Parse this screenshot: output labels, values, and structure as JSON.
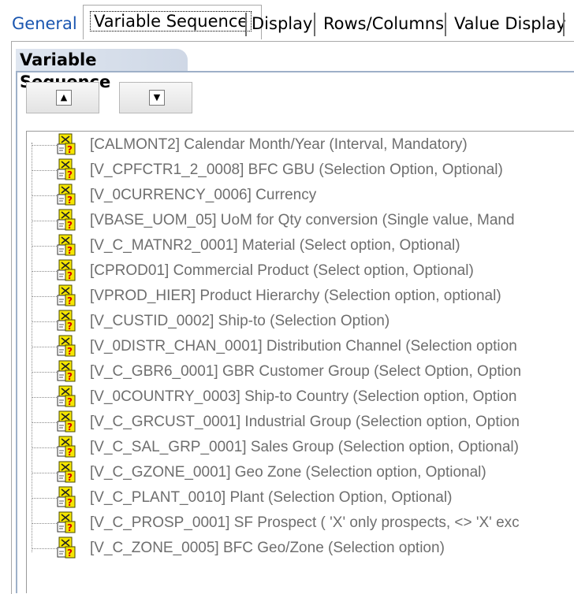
{
  "tabs": [
    {
      "label": "General"
    },
    {
      "label": "Variable Sequence"
    },
    {
      "label": "Display"
    },
    {
      "label": "Rows/Columns"
    },
    {
      "label": "Value Display"
    }
  ],
  "group": {
    "title": "Variable Sequence"
  },
  "buttons": {
    "up_icon": "arrow-up-icon",
    "down_icon": "arrow-down-icon"
  },
  "variables": [
    "[CALMONT2] Calendar Month/Year (Interval, Mandatory)",
    "[V_CPFCTR1_2_0008] BFC GBU (Selection Option, Optional)",
    "[V_0CURRENCY_0006] Currency",
    "[VBASE_UOM_05] UoM for Qty conversion (Single value, Mand",
    "[V_C_MATNR2_0001] Material (Select option, Optional)",
    "[CPROD01] Commercial Product (Select option, Optional)",
    "[VPROD_HIER] Product Hierarchy (Selection option, optional)",
    "[V_CUSTID_0002] Ship-to (Selection Option)",
    "[V_0DISTR_CHAN_0001] Distribution Channel (Selection option",
    "[V_C_GBR6_0001] GBR Customer Group (Select Option, Option",
    "[V_0COUNTRY_0003] Ship-to Country (Selection option, Option",
    "[V_C_GRCUST_0001] Industrial Group (Selection option, Option",
    "[V_C_SAL_GRP_0001] Sales Group (Selection option, Optional)",
    "[V_C_GZONE_0001] Geo Zone (Selection option, Optional)",
    "[V_C_PLANT_0010] Plant (Selection Option, Optional)",
    "[V_C_PROSP_0001] SF Prospect ( 'X' only prospects, <> 'X' exc",
    "[V_C_ZONE_0005] BFC Geo/Zone (Selection option)"
  ],
  "colors": {
    "tab_general": "#1a56b0",
    "group_header": "#dfe6f0",
    "label_gray": "#6e6e6e"
  }
}
